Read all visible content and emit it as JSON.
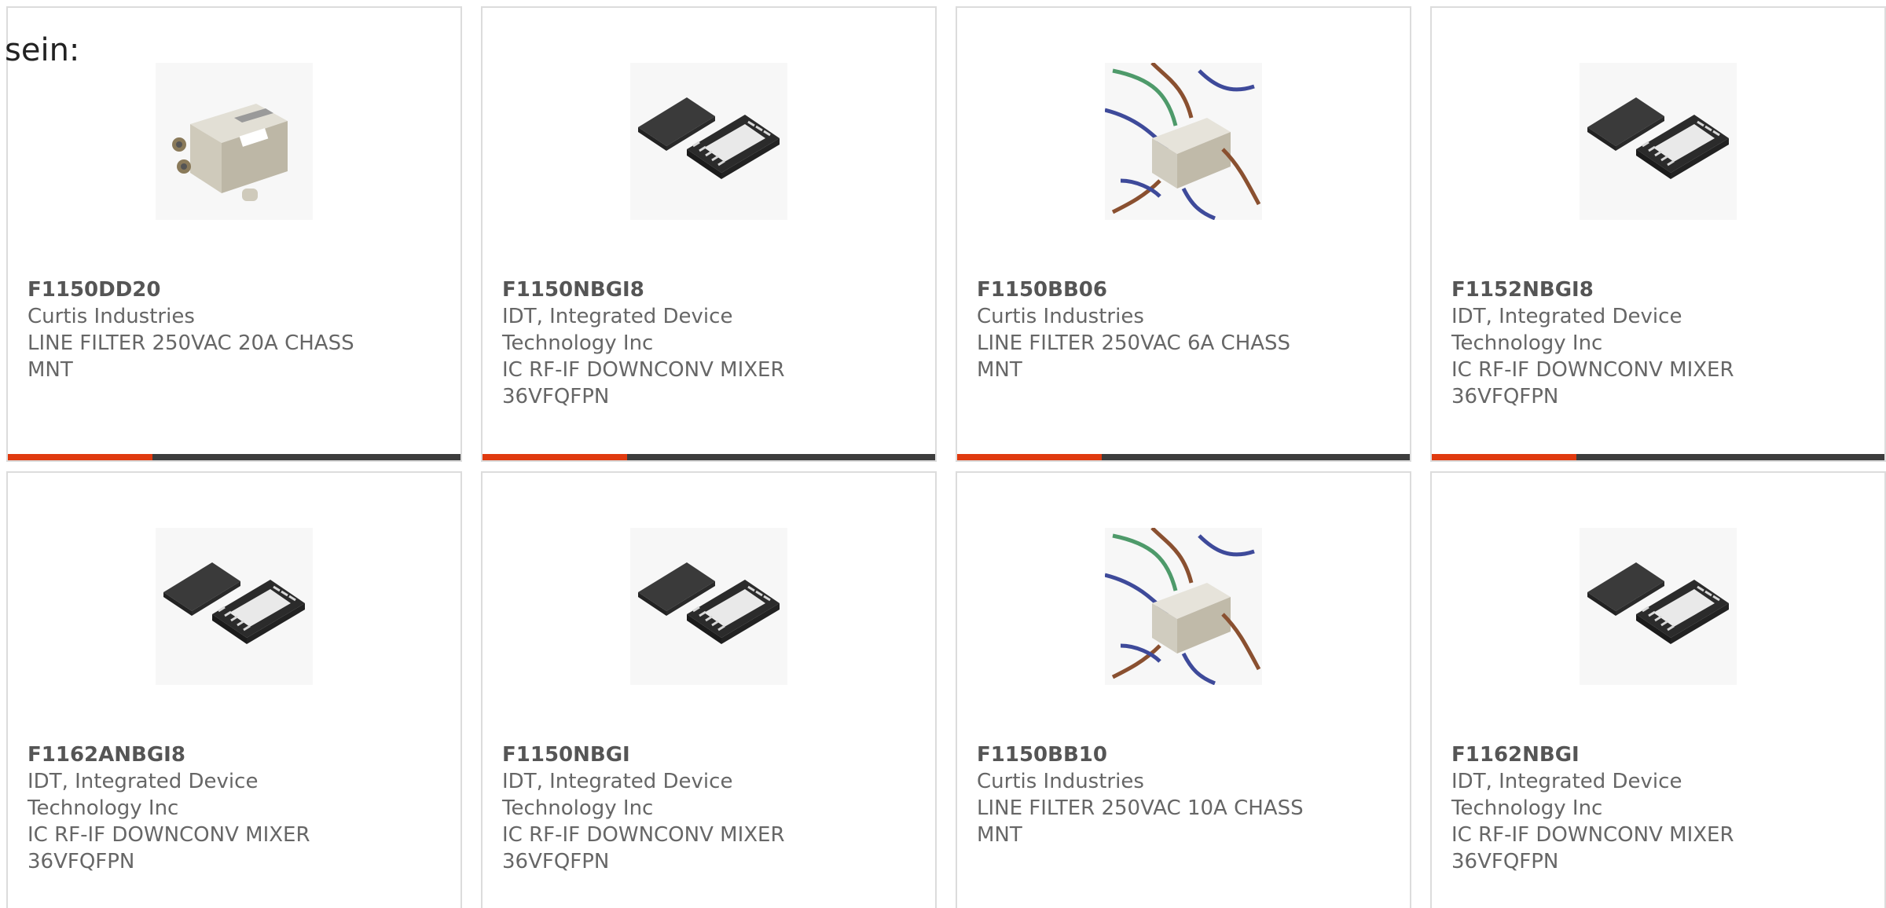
{
  "overlay_text": "sein:",
  "colors": {
    "accent": "#e03a0f",
    "bar": "#3d3d3d",
    "border": "#dcdcdc",
    "text": "#666666"
  },
  "cards": [
    {
      "part_number": "F1150DD20",
      "manufacturer": "Curtis Industries",
      "description": "LINE FILTER 250VAC 20A CHASS MNT",
      "image_type": "line-filter"
    },
    {
      "part_number": "F1150NBGI8",
      "manufacturer": "IDT, Integrated Device Technology Inc",
      "description": "IC RF-IF DOWNCONV MIXER 36VFQFPN",
      "image_type": "qfn-chip"
    },
    {
      "part_number": "F1150BB06",
      "manufacturer": "Curtis Industries",
      "description": "LINE FILTER 250VAC 6A CHASS MNT",
      "image_type": "line-filter-wired"
    },
    {
      "part_number": "F1152NBGI8",
      "manufacturer": "IDT, Integrated Device Technology Inc",
      "description": "IC RF-IF DOWNCONV MIXER 36VFQFPN",
      "image_type": "qfn-chip"
    },
    {
      "part_number": "F1162ANBGI8",
      "manufacturer": "IDT, Integrated Device Technology Inc",
      "description": "IC RF-IF DOWNCONV MIXER 36VFQFPN",
      "image_type": "qfn-chip"
    },
    {
      "part_number": "F1150NBGI",
      "manufacturer": "IDT, Integrated Device Technology Inc",
      "description": "IC RF-IF DOWNCONV MIXER 36VFQFPN",
      "image_type": "qfn-chip"
    },
    {
      "part_number": "F1150BB10",
      "manufacturer": "Curtis Industries",
      "description": "LINE FILTER 250VAC 10A CHASS MNT",
      "image_type": "line-filter-wired"
    },
    {
      "part_number": "F1162NBGI",
      "manufacturer": "IDT, Integrated Device Technology Inc",
      "description": "IC RF-IF DOWNCONV MIXER 36VFQFPN",
      "image_type": "qfn-chip"
    }
  ]
}
